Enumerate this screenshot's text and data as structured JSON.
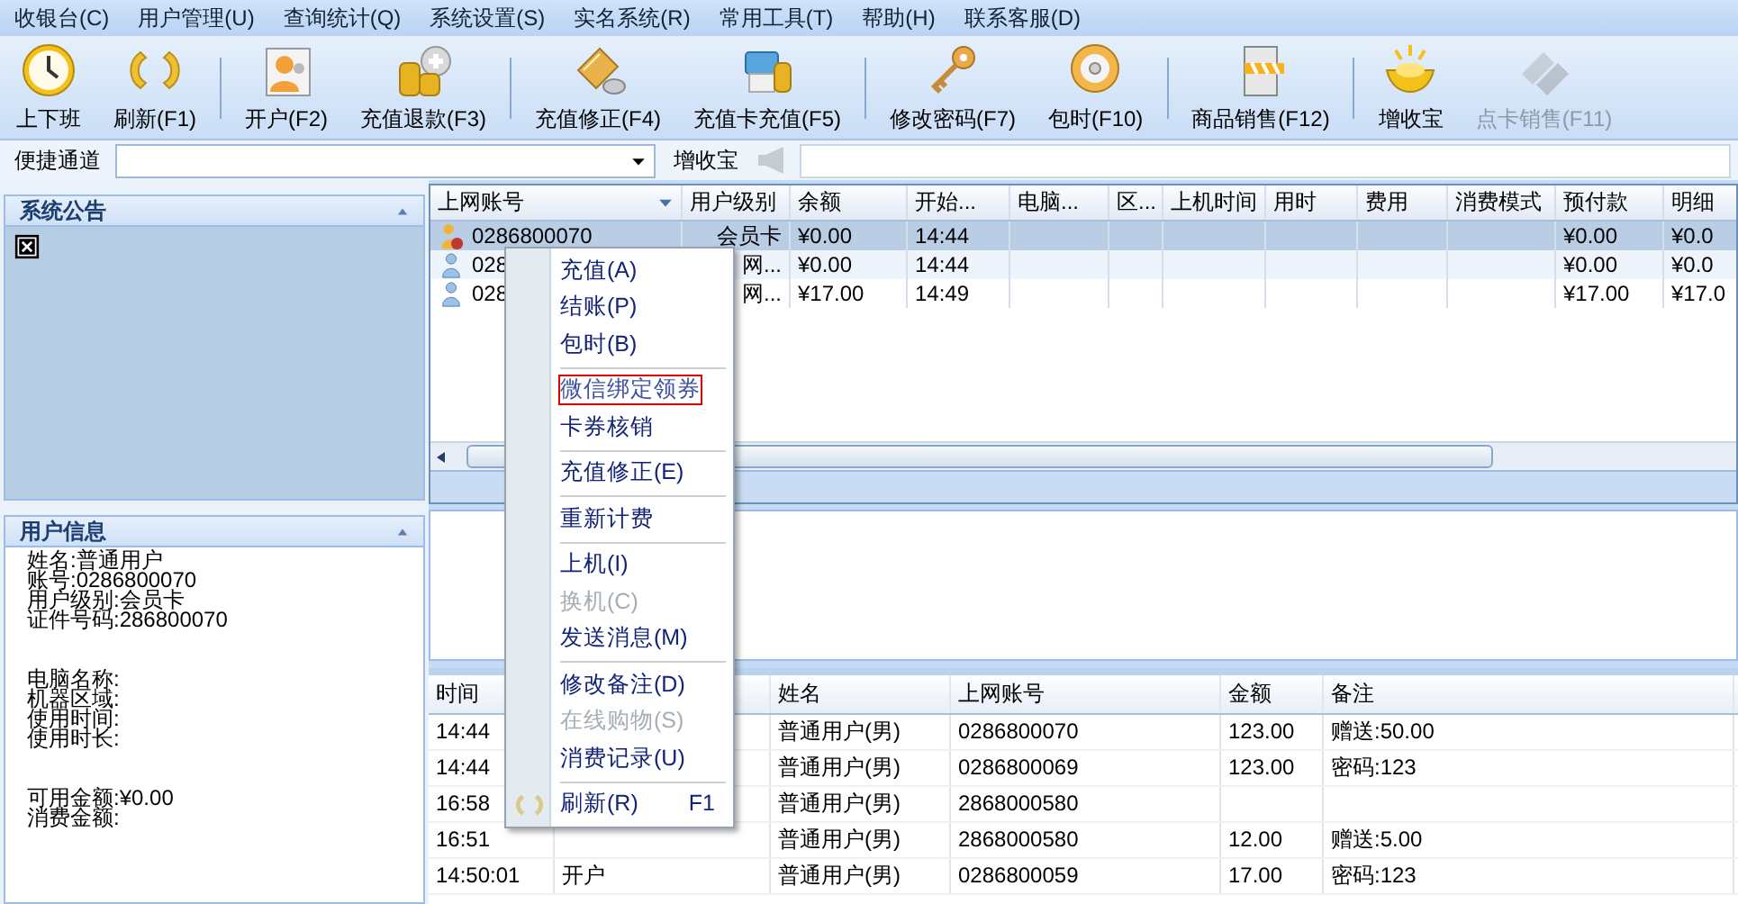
{
  "menu_bar": [
    "收银台(C)",
    "用户管理(U)",
    "查询统计(Q)",
    "系统设置(S)",
    "实名系统(R)",
    "常用工具(T)",
    "帮助(H)",
    "联系客服(D)"
  ],
  "toolbar": [
    {
      "kind": "button",
      "label": "上下班",
      "disabled": false
    },
    {
      "kind": "button",
      "label": "刷新(F1)",
      "disabled": false
    },
    {
      "kind": "separator"
    },
    {
      "kind": "button",
      "label": "开户(F2)",
      "disabled": false
    },
    {
      "kind": "button",
      "label": "充值退款(F3)",
      "disabled": false
    },
    {
      "kind": "separator"
    },
    {
      "kind": "button",
      "label": "充值修正(F4)",
      "disabled": false
    },
    {
      "kind": "button",
      "label": "充值卡充值(F5)",
      "disabled": false
    },
    {
      "kind": "separator"
    },
    {
      "kind": "button",
      "label": "修改密码(F7)",
      "disabled": false
    },
    {
      "kind": "button",
      "label": "包时(F10)",
      "disabled": false
    },
    {
      "kind": "separator"
    },
    {
      "kind": "button",
      "label": "商品销售(F12)",
      "disabled": false
    },
    {
      "kind": "separator"
    },
    {
      "kind": "button",
      "label": "增收宝",
      "disabled": false
    },
    {
      "kind": "button",
      "label": "点卡销售(F11)",
      "disabled": true
    }
  ],
  "quick_bar": {
    "label": "便捷通道",
    "button": "增收宝"
  },
  "notice_panel": {
    "title": "系统公告"
  },
  "user_panel": {
    "title": "用户信息",
    "groups": [
      [
        "姓名:普通用户",
        "账号:0286800070",
        "用户级别:会员卡",
        "证件号码:286800070"
      ],
      [
        "电脑名称:",
        "机器区域:",
        "使用时间:",
        "使用时长:"
      ],
      [
        "可用金额:¥0.00",
        "消费金额:"
      ]
    ]
  },
  "online_table": {
    "columns": {
      "account": "上网账号",
      "level": "用户级别",
      "balance": "余额",
      "start": "开始...",
      "computer": "电脑...",
      "area": "区...",
      "login_time": "上机时间",
      "duration": "用时",
      "fee": "费用",
      "mode": "消费模式",
      "prepaid": "预付款",
      "detail": "明细"
    },
    "rows": [
      {
        "kind": "vip",
        "selected": true,
        "account": "0286800070",
        "level": "会员卡",
        "balance": "¥0.00",
        "start": "14:44",
        "prepaid": "¥0.00",
        "detail": "¥0.0"
      },
      {
        "kind": "normal",
        "selected": false,
        "account": "028",
        "level": "网...",
        "balance": "¥0.00",
        "start": "14:44",
        "prepaid": "¥0.00",
        "detail": "¥0.0"
      },
      {
        "kind": "normal",
        "selected": false,
        "account": "028",
        "level": "网...",
        "balance": "¥17.00",
        "start": "14:49",
        "prepaid": "¥17.00",
        "detail": "¥17.0"
      }
    ]
  },
  "context_menu": [
    {
      "kind": "item",
      "label": "充值(A)",
      "disabled": false,
      "outlined": false
    },
    {
      "kind": "item",
      "label": "结账(P)",
      "disabled": false,
      "outlined": false
    },
    {
      "kind": "item",
      "label": "包时(B)",
      "disabled": false,
      "outlined": false
    },
    {
      "kind": "separator"
    },
    {
      "kind": "item",
      "label": "微信绑定领券",
      "disabled": false,
      "outlined": true
    },
    {
      "kind": "item",
      "label": "卡券核销",
      "disabled": false,
      "outlined": false
    },
    {
      "kind": "separator"
    },
    {
      "kind": "item",
      "label": "充值修正(E)",
      "disabled": false,
      "outlined": false
    },
    {
      "kind": "separator"
    },
    {
      "kind": "item",
      "label": "重新计费",
      "disabled": false,
      "outlined": false
    },
    {
      "kind": "separator"
    },
    {
      "kind": "item",
      "label": "上机(I)",
      "disabled": false,
      "outlined": false
    },
    {
      "kind": "item",
      "label": "换机(C)",
      "disabled": true,
      "outlined": false
    },
    {
      "kind": "item",
      "label": "发送消息(M)",
      "disabled": false,
      "outlined": false
    },
    {
      "kind": "separator"
    },
    {
      "kind": "item",
      "label": "修改备注(D)",
      "disabled": false,
      "outlined": false
    },
    {
      "kind": "item",
      "label": "在线购物(S)",
      "disabled": true,
      "outlined": false
    },
    {
      "kind": "item",
      "label": "消费记录(U)",
      "disabled": false,
      "outlined": false
    },
    {
      "kind": "separator"
    },
    {
      "kind": "refresh",
      "label": "刷新(R)",
      "shortcut": "F1",
      "disabled": false,
      "outlined": false
    }
  ],
  "log_table": {
    "columns": {
      "time": "时间",
      "name": "姓名",
      "account": "上网账号",
      "amount": "金额",
      "note": "备注"
    },
    "rows": [
      {
        "time": "14:44",
        "name": "普通用户(男)",
        "account": "0286800070",
        "amount": "123.00",
        "note": "赠送:50.00"
      },
      {
        "time": "14:44",
        "name": "普通用户(男)",
        "account": "0286800069",
        "amount": "123.00",
        "note": "密码:123"
      },
      {
        "time": "16:58",
        "name": "普通用户(男)",
        "account": "2868000580"
      },
      {
        "time": "16:51",
        "name": "普通用户(男)",
        "account": "2868000580",
        "amount": "12.00",
        "note": "赠送:5.00"
      },
      {
        "time": "14:50:01",
        "type": "开户",
        "name": "普通用户(男)",
        "account": "0286800059",
        "amount": "17.00",
        "note": "密码:123"
      }
    ]
  }
}
